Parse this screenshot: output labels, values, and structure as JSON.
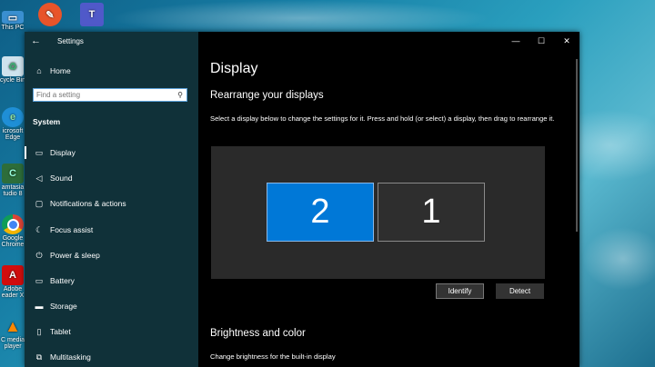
{
  "desktop": {
    "icons": [
      {
        "label": "This PC",
        "icon": "this-pc-icon"
      },
      {
        "label": "",
        "icon": "paint-app-icon"
      },
      {
        "label": "",
        "icon": "teams-icon"
      },
      {
        "label": "cycle Bin",
        "icon": "recycle-bin-icon"
      },
      {
        "label": "icrosoft Edge",
        "icon": "edge-icon"
      },
      {
        "label": "amtasia tudio 8",
        "icon": "camtasia-icon"
      },
      {
        "label": "Google Chrome",
        "icon": "chrome-icon"
      },
      {
        "label": "Adobe eader X",
        "icon": "adobe-reader-icon"
      },
      {
        "label": "C media player",
        "icon": "vlc-icon"
      }
    ]
  },
  "window": {
    "title": "Settings",
    "caption": {
      "minimize": "—",
      "maximize": "☐",
      "close": "✕"
    }
  },
  "sidebar": {
    "home": "Home",
    "search_placeholder": "Find a setting",
    "section": "System",
    "items": [
      {
        "label": "Display",
        "icon": "monitor-icon",
        "glyph": "▭"
      },
      {
        "label": "Sound",
        "icon": "speaker-icon",
        "glyph": "🔈"
      },
      {
        "label": "Notifications & actions",
        "icon": "notification-icon",
        "glyph": "▢"
      },
      {
        "label": "Focus assist",
        "icon": "moon-icon",
        "glyph": "☾"
      },
      {
        "label": "Power & sleep",
        "icon": "power-icon",
        "glyph": "⏻"
      },
      {
        "label": "Battery",
        "icon": "battery-icon",
        "glyph": "▭"
      },
      {
        "label": "Storage",
        "icon": "storage-icon",
        "glyph": "▬"
      },
      {
        "label": "Tablet",
        "icon": "tablet-icon",
        "glyph": "▯"
      },
      {
        "label": "Multitasking",
        "icon": "multitasking-icon",
        "glyph": "⧉"
      }
    ]
  },
  "main": {
    "page_title": "Display",
    "rearrange_heading": "Rearrange your displays",
    "rearrange_desc": "Select a display below to change the settings for it. Press and hold (or select) a display, then drag to rearrange it.",
    "monitors": [
      {
        "number": "2",
        "selected": true
      },
      {
        "number": "1",
        "selected": false
      }
    ],
    "identify_button": "Identify",
    "detect_button": "Detect",
    "brightness_heading": "Brightness and color",
    "brightness_desc": "Change brightness for the built-in display"
  },
  "colors": {
    "accent": "#0078d7",
    "window_bg": "#000000",
    "sidebar_bg": "#143c46"
  }
}
